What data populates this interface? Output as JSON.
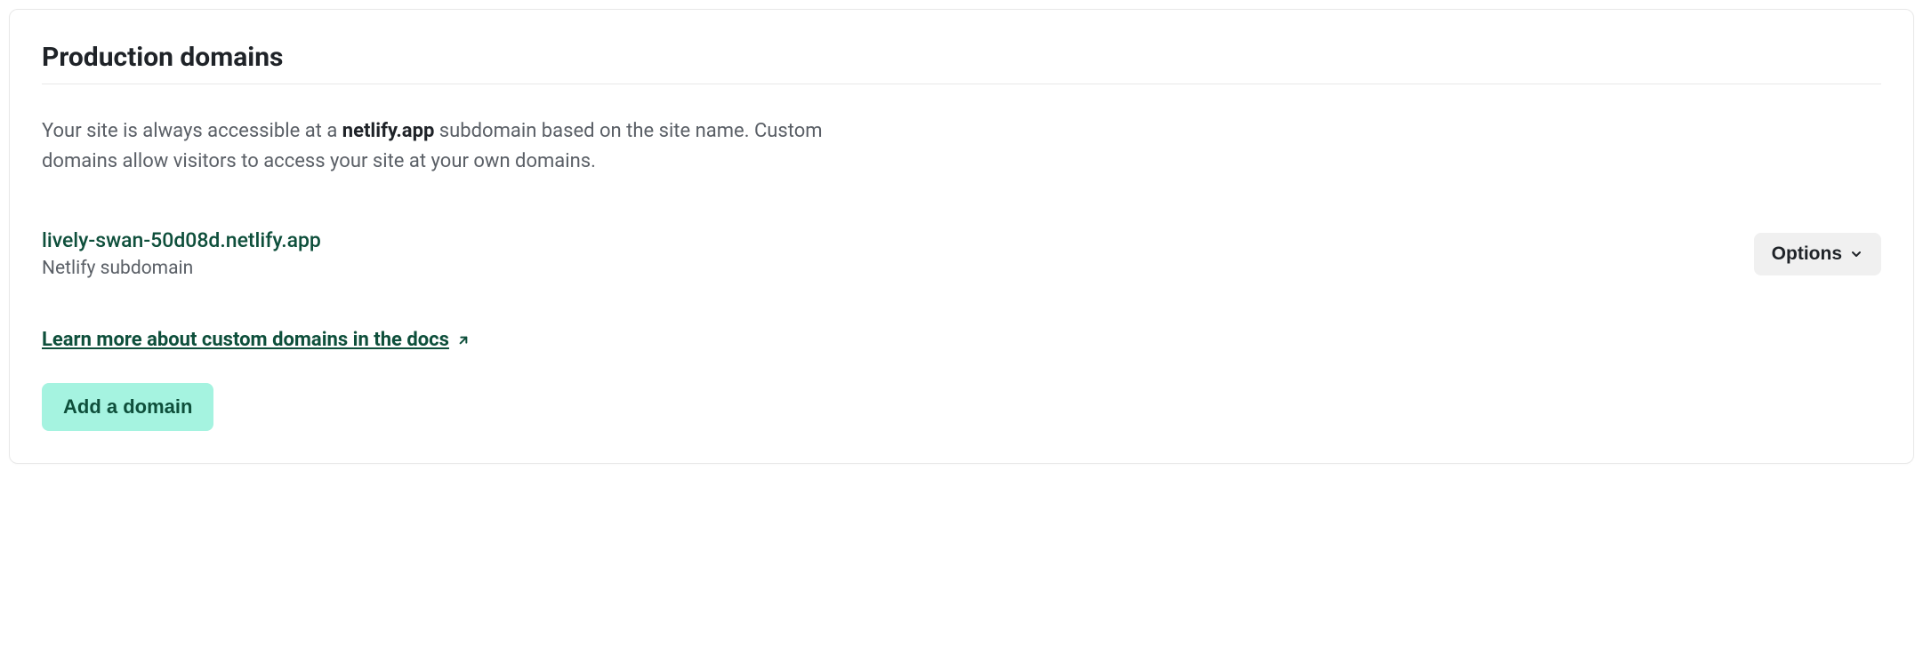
{
  "card": {
    "title": "Production domains",
    "description_prefix": "Your site is always accessible at a ",
    "description_bold": "netlify.app",
    "description_suffix": " subdomain based on the site name. Custom domains allow visitors to access your site at your own domains."
  },
  "domain": {
    "url": "lively-swan-50d08d.netlify.app",
    "sublabel": "Netlify subdomain"
  },
  "options": {
    "label": "Options"
  },
  "learn_link": {
    "text": "Learn more about custom domains in the docs"
  },
  "add_domain": {
    "label": "Add a domain"
  }
}
